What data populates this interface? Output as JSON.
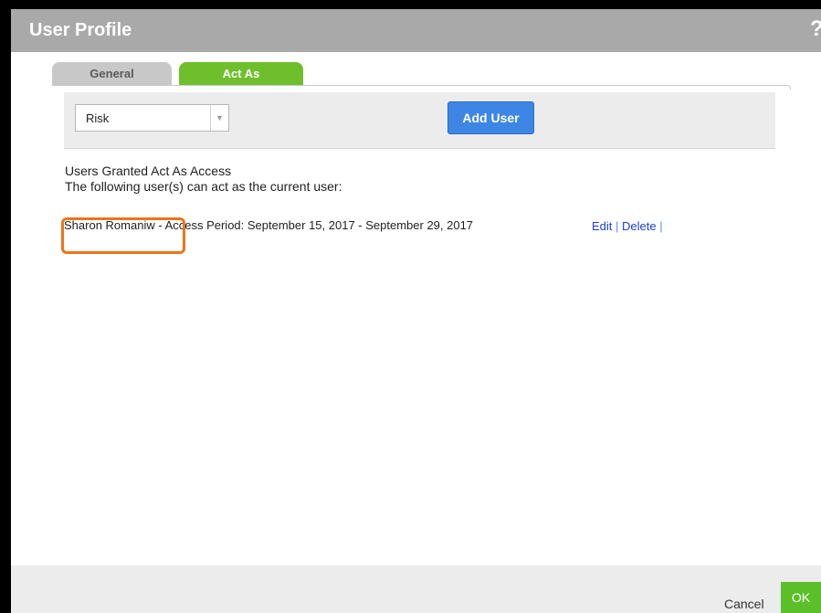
{
  "dialog": {
    "title": "User Profile",
    "help_label": "?"
  },
  "tabs": [
    {
      "label": "General",
      "selected": false
    },
    {
      "label": "Act As",
      "selected": true
    }
  ],
  "toolbar": {
    "select_value": "Risk",
    "select_arrow": "▼",
    "add_user_label": "Add User"
  },
  "section": {
    "title": "Users Granted Act As Access",
    "subtitle": "The following user(s) can act as the current user:"
  },
  "users": [
    {
      "name": "Sharon Romaniw",
      "separator": " - ",
      "period": "Access Period: September 15, 2017 - September 29, 2017",
      "edit_label": "Edit",
      "delete_label": "Delete"
    }
  ],
  "footer": {
    "cancel_label": "Cancel",
    "ok_label": "OK"
  },
  "colors": {
    "active_tab": "#6fbf2d",
    "add_user_button": "#3d86e6",
    "ok_button": "#5bbf2a",
    "highlight": "#ee7418",
    "link": "#1a3fd8"
  }
}
